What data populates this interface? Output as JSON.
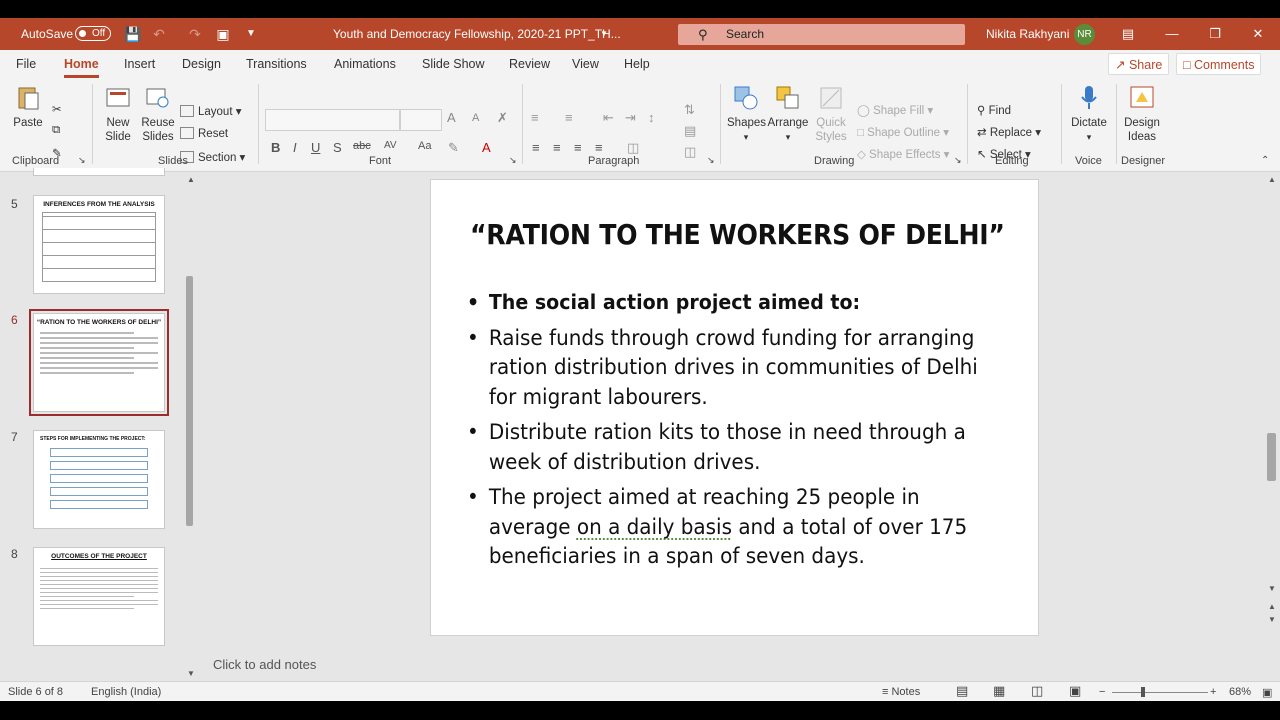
{
  "titlebar": {
    "autosave_label": "AutoSave",
    "autosave_state": "Off",
    "doc_title": "Youth and Democracy Fellowship, 2020-21 PPT_TH...",
    "search_placeholder": "Search",
    "user_name": "Nikita Rakhyani",
    "user_initials": "NR"
  },
  "tabs": [
    "File",
    "Home",
    "Insert",
    "Design",
    "Transitions",
    "Animations",
    "Slide Show",
    "Review",
    "View",
    "Help"
  ],
  "actions": {
    "share": "Share",
    "comments": "Comments"
  },
  "ribbon": {
    "clipboard": {
      "paste": "Paste",
      "label": "Clipboard"
    },
    "slides": {
      "new_slide_1": "New",
      "new_slide_2": "Slide",
      "reuse_1": "Reuse",
      "reuse_2": "Slides",
      "layout": "Layout",
      "reset": "Reset",
      "section": "Section",
      "label": "Slides"
    },
    "font": {
      "label": "Font",
      "bold": "B",
      "italic": "I",
      "underline": "U",
      "strike": "S",
      "spacing": "AV",
      "aa_up": "A",
      "aa_down": "A"
    },
    "paragraph": {
      "label": "Paragraph"
    },
    "drawing": {
      "shapes": "Shapes",
      "arrange": "Arrange",
      "quick_1": "Quick",
      "quick_2": "Styles",
      "shape_fill": "Shape Fill",
      "shape_outline": "Shape Outline",
      "shape_effects": "Shape Effects",
      "label": "Drawing"
    },
    "editing": {
      "find": "Find",
      "replace": "Replace",
      "select": "Select",
      "label": "Editing"
    },
    "voice": {
      "dictate": "Dictate",
      "label": "Voice"
    },
    "designer": {
      "ideas_1": "Design",
      "ideas_2": "Ideas",
      "label": "Designer"
    }
  },
  "thumbnails": [
    {
      "num": "5",
      "title": "INFERENCES FROM THE ANALYSIS"
    },
    {
      "num": "6",
      "title": "“RATION TO THE WORKERS OF DELHI”"
    },
    {
      "num": "7",
      "title": "STEPS FOR IMPLEMENTING THE PROJECT:"
    },
    {
      "num": "8",
      "title": "OUTCOMES OF THE PROJECT"
    }
  ],
  "slide": {
    "title": "“RATION TO THE WORKERS OF DELHI”",
    "bullets": {
      "b1": "The social action project aimed to:",
      "b2": "Raise funds through crowd funding for arranging ration distribution drives in communities of Delhi for migrant labourers.",
      "b3": "Distribute ration kits to those in need through a week of distribution drives.",
      "b4_pre": "The project aimed at reaching 25 people in average ",
      "b4_mid": "on a daily basis",
      "b4_post": " and a total of over 175 beneficiaries in a span of seven days."
    }
  },
  "notes_placeholder": "Click to add notes",
  "status": {
    "slide_pos": "Slide 6 of 8",
    "language": "English (India)",
    "notes": "Notes",
    "zoom": "68%"
  }
}
